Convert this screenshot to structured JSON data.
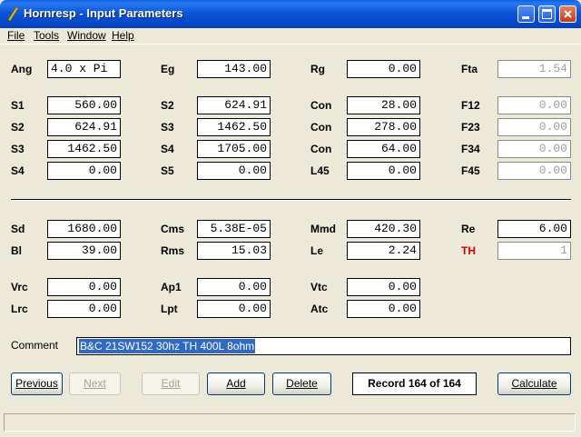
{
  "window": {
    "title": "Hornresp - Input Parameters",
    "colors": {
      "title_bar": "#0a56d8",
      "face": "#ece9d8",
      "th_label": "#d40000",
      "selection": "#316ac5"
    }
  },
  "menu": [
    "File",
    "Tools",
    "Window",
    "Help"
  ],
  "params": {
    "ang": {
      "label": "Ang",
      "value": "4.0 x Pi"
    },
    "eg": {
      "label": "Eg",
      "value": "143.00"
    },
    "rg": {
      "label": "Rg",
      "value": "0.00"
    },
    "fta": {
      "label": "Fta",
      "value": "1.54"
    },
    "s1": {
      "label": "S1",
      "value": "560.00"
    },
    "s2a": {
      "label": "S2",
      "value": "624.91"
    },
    "con1": {
      "label": "Con",
      "value": "28.00"
    },
    "f12": {
      "label": "F12",
      "value": "0.00"
    },
    "s2b": {
      "label": "S2",
      "value": "624.91"
    },
    "s3a": {
      "label": "S3",
      "value": "1462.50"
    },
    "con2": {
      "label": "Con",
      "value": "278.00"
    },
    "f23": {
      "label": "F23",
      "value": "0.00"
    },
    "s3b": {
      "label": "S3",
      "value": "1462.50"
    },
    "s4a": {
      "label": "S4",
      "value": "1705.00"
    },
    "con3": {
      "label": "Con",
      "value": "64.00"
    },
    "f34": {
      "label": "F34",
      "value": "0.00"
    },
    "s4b": {
      "label": "S4",
      "value": "0.00"
    },
    "s5": {
      "label": "S5",
      "value": "0.00"
    },
    "l45": {
      "label": "L45",
      "value": "0.00"
    },
    "f45": {
      "label": "F45",
      "value": "0.00"
    },
    "sd": {
      "label": "Sd",
      "value": "1680.00"
    },
    "cms": {
      "label": "Cms",
      "value": "5.38E-05"
    },
    "mmd": {
      "label": "Mmd",
      "value": "420.30"
    },
    "re": {
      "label": "Re",
      "value": "6.00"
    },
    "bl": {
      "label": "Bl",
      "value": "39.00"
    },
    "rms": {
      "label": "Rms",
      "value": "15.03"
    },
    "le": {
      "label": "Le",
      "value": "2.24"
    },
    "th": {
      "label": "TH",
      "value": "1"
    },
    "vrc": {
      "label": "Vrc",
      "value": "0.00"
    },
    "ap1": {
      "label": "Ap1",
      "value": "0.00"
    },
    "vtc": {
      "label": "Vtc",
      "value": "0.00"
    },
    "lrc": {
      "label": "Lrc",
      "value": "0.00"
    },
    "lpt": {
      "label": "Lpt",
      "value": "0.00"
    },
    "atc": {
      "label": "Atc",
      "value": "0.00"
    }
  },
  "comment": {
    "label": "Comment",
    "value": "B&C 21SW152 30hz TH 400L 8ohm"
  },
  "buttons": {
    "previous": "Previous",
    "next": "Next",
    "edit": "Edit",
    "add": "Add",
    "delete": "Delete",
    "calculate": "Calculate"
  },
  "record": "Record 164 of 164"
}
